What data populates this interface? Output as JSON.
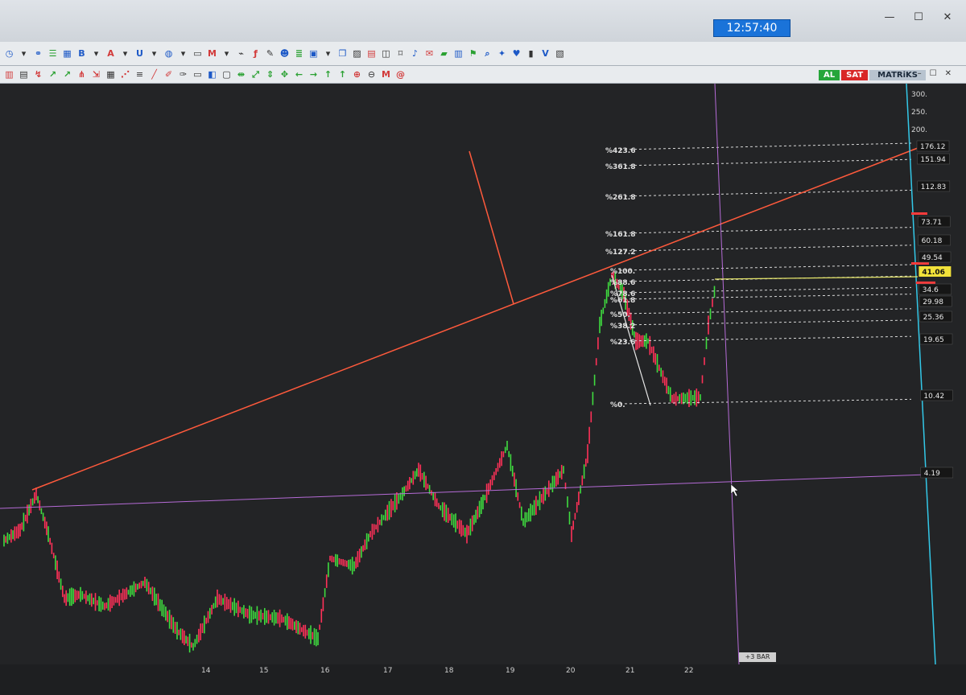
{
  "window": {
    "clock": "12:57:40",
    "buttons": {
      "minimize": "—",
      "maximize": "☐",
      "close": "✕"
    }
  },
  "toolbar_badges": {
    "al": "AL",
    "sat": "SAT",
    "brand": "MATRiKS"
  },
  "chart": {
    "axis_ticks": [
      "300.",
      "250.",
      "200."
    ],
    "price_labels": [
      "176.12",
      "151.94",
      "112.83",
      "73.71",
      "60.18",
      "49.54",
      "41.06",
      "34.6",
      "29.98",
      "25.36",
      "19.65",
      "10.42",
      "4.19"
    ],
    "fib_labels": [
      "%423.6",
      "%361.8",
      "%261.8",
      "%161.8",
      "%127.2",
      "%100.",
      "%88.6",
      "%78.6",
      "%61.8",
      "%50.",
      "%38.2",
      "%23.6",
      "%0."
    ],
    "date_labels": [
      "14",
      "15",
      "16",
      "17",
      "18",
      "19",
      "20",
      "21",
      "22"
    ],
    "bar_tag": "+3 BAR",
    "colors": {
      "background": "#232426",
      "trendline": "#ff5a3c",
      "crosshair": "#b56bd6",
      "axis": "#33c8e8",
      "up": "#3fdc3f",
      "down": "#ff3158"
    }
  }
}
